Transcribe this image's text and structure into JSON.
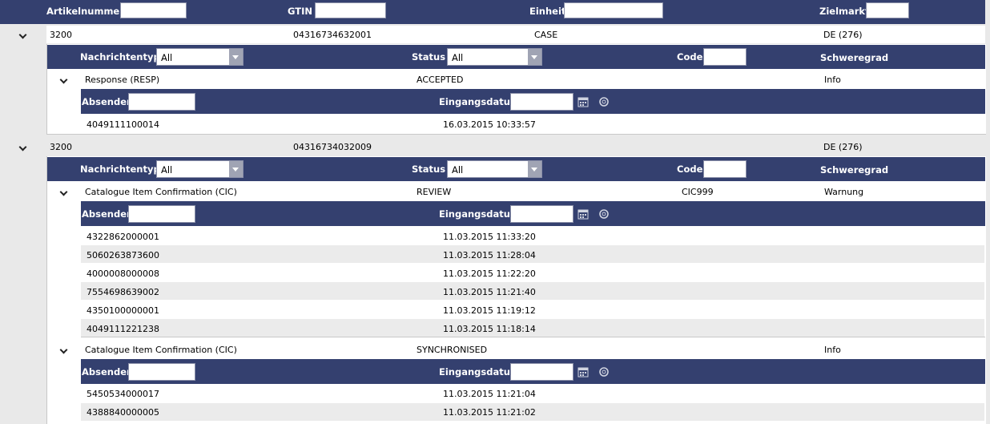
{
  "filters": {
    "artikelnummer_label": "Artikelnummer",
    "gtin_label": "GTIN",
    "einheit_label": "Einheit",
    "zielmarkt_label": "Zielmarkt"
  },
  "sub_filters": {
    "nachrichtentyp_label": "Nachrichtentyp",
    "nachrichtentyp_value": "All",
    "status_label": "Status",
    "status_value": "All",
    "code_label": "Code",
    "schweregrad_label": "Schweregrad"
  },
  "detail_filters": {
    "absender_label": "Absender",
    "eingangsdatum_label": "Eingangsdatum"
  },
  "articles": [
    {
      "artikelnummer": "3200",
      "gtin": "04316734632001",
      "einheit": "CASE",
      "zielmarkt": "DE (276)",
      "messages": [
        {
          "typ": "Response (RESP)",
          "status": "ACCEPTED",
          "code": "",
          "schweregrad": "Info",
          "entries": [
            {
              "absender": "4049111100014",
              "datum": "16.03.2015 10:33:57"
            }
          ]
        }
      ]
    },
    {
      "artikelnummer": "3200",
      "gtin": "04316734032009",
      "einheit": "",
      "zielmarkt": "DE (276)",
      "messages": [
        {
          "typ": "Catalogue Item Confirmation (CIC)",
          "status": "REVIEW",
          "code": "CIC999",
          "schweregrad": "Warnung",
          "entries": [
            {
              "absender": "4322862000001",
              "datum": "11.03.2015 11:33:20"
            },
            {
              "absender": "5060263873600",
              "datum": "11.03.2015 11:28:04"
            },
            {
              "absender": "4000008000008",
              "datum": "11.03.2015 11:22:20"
            },
            {
              "absender": "7554698639002",
              "datum": "11.03.2015 11:21:40"
            },
            {
              "absender": "4350100000001",
              "datum": "11.03.2015 11:19:12"
            },
            {
              "absender": "4049111221238",
              "datum": "11.03.2015 11:18:14"
            }
          ]
        },
        {
          "typ": "Catalogue Item Confirmation (CIC)",
          "status": "SYNCHRONISED",
          "code": "",
          "schweregrad": "Info",
          "entries": [
            {
              "absender": "5450534000017",
              "datum": "11.03.2015 11:21:04"
            },
            {
              "absender": "4388840000005",
              "datum": "11.03.2015 11:21:02"
            }
          ]
        }
      ]
    }
  ],
  "icons": {
    "expand": "chevron-down-icon",
    "calendar": "calendar-icon",
    "reset": "reset-icon"
  },
  "colors": {
    "header_bg": "#34406f",
    "alt_row": "#ebebeb"
  }
}
